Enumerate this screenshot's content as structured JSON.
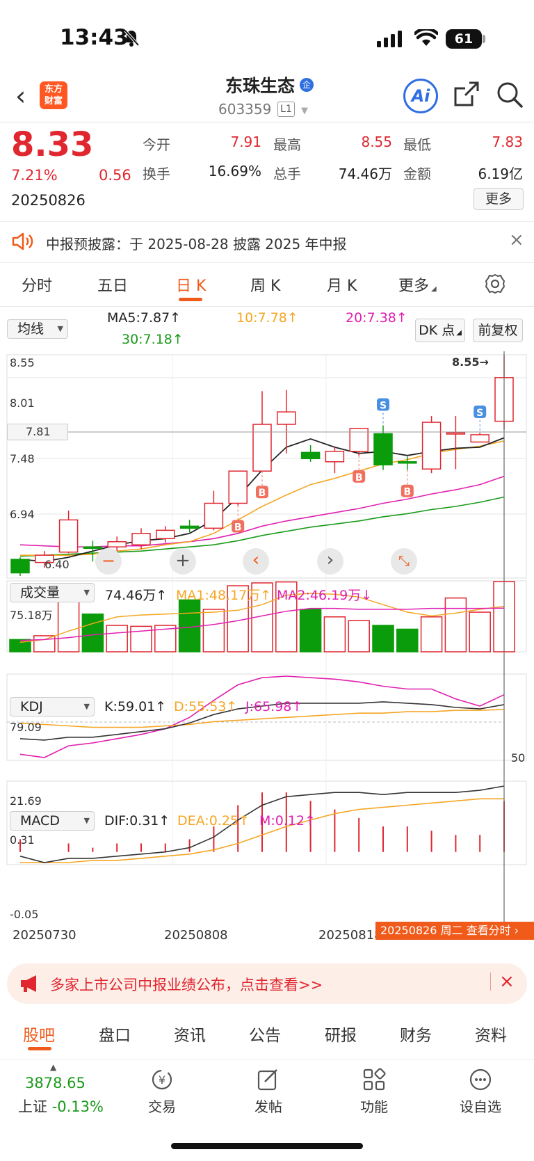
{
  "status": {
    "time": "13:43",
    "battery": "61"
  },
  "header": {
    "logo_line1": "东方",
    "logo_line2": "财富",
    "name": "东珠生态",
    "badge": "企",
    "code": "603359",
    "level": "L1",
    "ai_label": "Ai"
  },
  "quote": {
    "price": "8.33",
    "change_pct": "7.21%",
    "change_amt": "0.56",
    "date": "20250826",
    "fields": [
      {
        "label": "今开",
        "value": "7.91",
        "color": "#e0262f"
      },
      {
        "label": "最高",
        "value": "8.55",
        "color": "#e0262f"
      },
      {
        "label": "最低",
        "value": "7.83",
        "color": "#e0262f"
      },
      {
        "label": "换手",
        "value": "16.69%",
        "color": "#222222"
      },
      {
        "label": "总手",
        "value": "74.46万",
        "color": "#222222"
      },
      {
        "label": "金额",
        "value": "6.19亿",
        "color": "#222222"
      }
    ],
    "more_label": "更多"
  },
  "notice": {
    "text": "中报预披露：于 2025-08-28 披露 2025 年中报"
  },
  "period_tabs": [
    "分时",
    "五日",
    "日 K",
    "周 K",
    "月 K",
    "更多"
  ],
  "period_active": "日 K",
  "ma_panel": {
    "selector": "均线",
    "ma5": "MA5:7.87↑",
    "ma10": "10:7.78↑",
    "ma20": "20:7.38↑",
    "ma30": "30:7.18↑",
    "dk_button": "DK 点",
    "adjust_button": "前复权",
    "y_top": "8.55",
    "y_2": "8.01",
    "cursor_price": "7.81",
    "y_3": "7.48",
    "y_4": "6.94",
    "high_marker": "8.55→",
    "low_marker": "6.40",
    "buy_marker": "B",
    "sell_marker": "S"
  },
  "vol_panel": {
    "selector": "成交量",
    "vol": "74.46万↑",
    "ma1": "MA1:48.17万↑",
    "ma2": "MA2:46.19万↓",
    "y_top": "75.18万"
  },
  "kdj_panel": {
    "selector": "KDJ",
    "k": "K:59.01↑",
    "d": "D:55.53↑",
    "j": "J:65.98↑",
    "y_top": "79.09",
    "y_bottom": "21.69",
    "mid": "50"
  },
  "macd_panel": {
    "selector": "MACD",
    "dif": "DIF:0.31↑",
    "dea": "DEA:0.25↑",
    "m": "M:0.12↑",
    "y_top": "0.31",
    "y_bottom": "-0.05"
  },
  "dates": [
    "20250730",
    "20250808",
    "20250818"
  ],
  "pointer_banner": "20250826 周二 查看分时",
  "chart_data": {
    "type": "candlestick",
    "dates_shown": [
      "20250730",
      "20250808",
      "20250818"
    ],
    "ylim": [
      6.4,
      8.55
    ],
    "candles": [
      {
        "o": 6.58,
        "c": 6.45,
        "h": 6.6,
        "l": 6.42,
        "up": false
      },
      {
        "o": 6.55,
        "c": 6.62,
        "h": 6.66,
        "l": 6.5,
        "up": true
      },
      {
        "o": 6.65,
        "c": 6.96,
        "h": 7.05,
        "l": 6.64,
        "up": true
      },
      {
        "o": 6.7,
        "c": 6.7,
        "h": 6.76,
        "l": 6.56,
        "up": false
      },
      {
        "o": 6.7,
        "c": 6.75,
        "h": 6.8,
        "l": 6.62,
        "up": true
      },
      {
        "o": 6.72,
        "c": 6.83,
        "h": 6.88,
        "l": 6.68,
        "up": true
      },
      {
        "o": 6.78,
        "c": 6.86,
        "h": 6.9,
        "l": 6.74,
        "up": true
      },
      {
        "o": 6.9,
        "c": 6.88,
        "h": 6.96,
        "l": 6.84,
        "up": false
      },
      {
        "o": 6.88,
        "c": 7.12,
        "h": 7.24,
        "l": 6.86,
        "up": true
      },
      {
        "o": 7.12,
        "c": 7.43,
        "h": 7.43,
        "l": 7.1,
        "up": true
      },
      {
        "o": 7.43,
        "c": 7.88,
        "h": 8.2,
        "l": 7.43,
        "up": true
      },
      {
        "o": 7.88,
        "c": 8.0,
        "h": 8.21,
        "l": 7.6,
        "up": true
      },
      {
        "o": 7.61,
        "c": 7.55,
        "h": 7.68,
        "l": 7.52,
        "up": false
      },
      {
        "o": 7.52,
        "c": 7.62,
        "h": 7.66,
        "l": 7.41,
        "up": true
      },
      {
        "o": 7.62,
        "c": 7.84,
        "h": 7.84,
        "l": 7.58,
        "up": true
      },
      {
        "o": 7.79,
        "c": 7.49,
        "h": 7.87,
        "l": 7.44,
        "up": false
      },
      {
        "o": 7.52,
        "c": 7.52,
        "h": 7.57,
        "l": 7.44,
        "up": false
      },
      {
        "o": 7.45,
        "c": 7.9,
        "h": 7.96,
        "l": 7.41,
        "up": true
      },
      {
        "o": 7.79,
        "c": 7.8,
        "h": 7.96,
        "l": 7.45,
        "up": true
      },
      {
        "o": 7.71,
        "c": 7.78,
        "h": 7.8,
        "l": 7.71,
        "up": true
      },
      {
        "o": 7.91,
        "c": 8.33,
        "h": 8.55,
        "l": 7.83,
        "up": true
      }
    ],
    "ma5": [
      6.58,
      6.56,
      6.6,
      6.66,
      6.72,
      6.76,
      6.78,
      6.83,
      6.96,
      7.18,
      7.44,
      7.66,
      7.74,
      7.66,
      7.6,
      7.62,
      7.58,
      7.62,
      7.65,
      7.66,
      7.75
    ],
    "ma10": [
      6.62,
      6.62,
      6.62,
      6.63,
      6.66,
      6.68,
      6.72,
      6.75,
      6.83,
      6.96,
      7.09,
      7.2,
      7.3,
      7.36,
      7.43,
      7.5,
      7.54,
      7.6,
      7.64,
      7.67,
      7.72
    ],
    "ma20": [
      6.72,
      6.71,
      6.7,
      6.7,
      6.71,
      6.71,
      6.73,
      6.75,
      6.78,
      6.83,
      6.9,
      6.95,
      6.99,
      7.03,
      7.07,
      7.12,
      7.16,
      7.21,
      7.25,
      7.3,
      7.38
    ],
    "ma30": [
      6.61,
      6.62,
      6.63,
      6.64,
      6.65,
      6.66,
      6.68,
      6.7,
      6.72,
      6.76,
      6.81,
      6.85,
      6.89,
      6.92,
      6.95,
      6.99,
      7.02,
      7.06,
      7.09,
      7.13,
      7.18
    ],
    "volume": [
      13,
      17,
      55,
      40,
      28,
      27,
      28,
      55,
      45,
      70,
      73,
      74,
      45,
      37,
      33,
      28,
      24,
      37,
      57,
      42,
      74.46
    ],
    "vol_ma1": [
      10,
      13,
      22,
      30,
      37,
      39,
      40,
      41,
      42,
      44,
      50,
      60,
      62,
      61,
      58,
      50,
      42,
      38,
      41,
      45,
      48.17
    ],
    "vol_ma2": [
      12,
      13,
      15,
      18,
      20,
      22,
      24,
      26,
      29,
      33,
      38,
      43,
      46,
      46,
      45,
      45,
      45,
      46,
      46,
      46,
      46.19
    ],
    "kdj_k": [
      35,
      34,
      36,
      36,
      38,
      40,
      42,
      46,
      52,
      56,
      58,
      60,
      60,
      60,
      60,
      61,
      60,
      59,
      57,
      56,
      59.01
    ],
    "kdj_d": [
      46,
      45,
      44,
      43,
      43,
      43,
      44,
      45,
      47,
      48,
      49,
      50,
      51,
      52,
      53,
      53,
      54,
      54,
      55,
      55,
      55.53
    ],
    "kdj_j": [
      24,
      21.69,
      30,
      32,
      35,
      38,
      42,
      50,
      62,
      73,
      78,
      79.09,
      78,
      77,
      75,
      72,
      70,
      70,
      63,
      58,
      65.98
    ],
    "macd_dif": [
      -0.02,
      -0.05,
      -0.03,
      -0.03,
      -0.02,
      -0.01,
      0.0,
      0.02,
      0.07,
      0.15,
      0.22,
      0.26,
      0.27,
      0.28,
      0.28,
      0.27,
      0.28,
      0.28,
      0.28,
      0.29,
      0.31
    ],
    "macd_dea": [
      -0.05,
      -0.05,
      -0.05,
      -0.04,
      -0.04,
      -0.03,
      -0.02,
      -0.01,
      0.01,
      0.04,
      0.08,
      0.12,
      0.15,
      0.18,
      0.2,
      0.21,
      0.22,
      0.23,
      0.24,
      0.25,
      0.25
    ],
    "macd_m": [
      0.03,
      0.0,
      0.02,
      0.01,
      0.02,
      0.02,
      0.02,
      0.03,
      0.06,
      0.11,
      0.14,
      0.14,
      0.12,
      0.1,
      0.08,
      0.06,
      0.06,
      0.05,
      0.04,
      0.04,
      0.12
    ]
  },
  "colors": {
    "up": "#e0262f",
    "down": "#0a9c0a",
    "ma5": "#222222",
    "ma10": "#f5a623",
    "ma20": "#e020b0",
    "ma30": "#1a9a1a",
    "accent": "#f05a1a"
  },
  "promo": {
    "text": "多家上市公司中报业绩公布，点击查看>>"
  },
  "bottom_tabs": [
    "股吧",
    "盘口",
    "资讯",
    "公告",
    "研报",
    "财务",
    "资料"
  ],
  "bottom_active": "股吧",
  "bottom_nav": {
    "index_value": "3878.65",
    "index_name": "上证",
    "index_pct": "-0.13%",
    "items": [
      "交易",
      "发帖",
      "功能",
      "设自选"
    ]
  }
}
